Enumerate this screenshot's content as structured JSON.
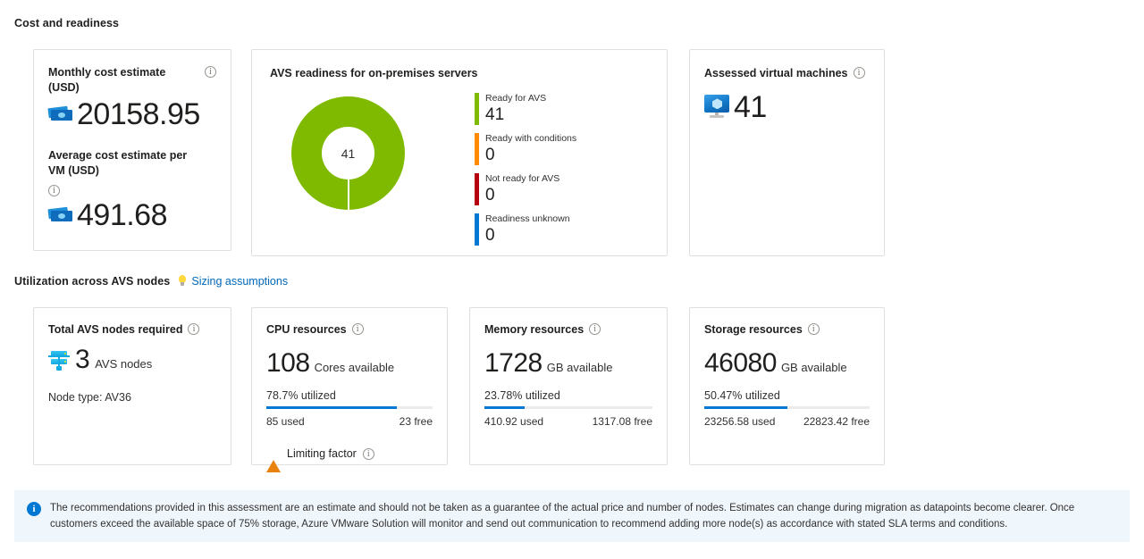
{
  "sections": {
    "cost_readiness_title": "Cost and readiness",
    "utilization_title": "Utilization across AVS nodes",
    "sizing_link": "Sizing assumptions"
  },
  "cost_card": {
    "monthly_label": "Monthly cost estimate (USD)",
    "monthly_value": "20158.95",
    "avg_label": "Average cost estimate per VM (USD)",
    "avg_value": "491.68"
  },
  "readiness_card": {
    "title": "AVS readiness for on-premises servers",
    "center_value": "41"
  },
  "assessed_card": {
    "title": "Assessed virtual machines",
    "value": "41"
  },
  "nodes_card": {
    "title": "Total AVS nodes required",
    "value": "3",
    "unit": "AVS nodes",
    "node_type": "Node type: AV36"
  },
  "cpu_card": {
    "title": "CPU resources",
    "value": "108",
    "unit": "Cores available",
    "utilized_text": "78.7% utilized",
    "utilized_percent": 78.7,
    "used_text": "85 used",
    "free_text": "23 free",
    "limiting_label": "Limiting factor"
  },
  "memory_card": {
    "title": "Memory resources",
    "value": "1728",
    "unit": "GB available",
    "utilized_text": "23.78% utilized",
    "utilized_percent": 23.78,
    "used_text": "410.92 used",
    "free_text": "1317.08 free"
  },
  "storage_card": {
    "title": "Storage resources",
    "value": "46080",
    "unit": "GB available",
    "utilized_text": "50.47% utilized",
    "utilized_percent": 50.47,
    "used_text": "23256.58 used",
    "free_text": "22823.42 free"
  },
  "banner": {
    "text": "The recommendations provided in this assessment are an estimate and should not be taken as a guarantee of the actual price and number of nodes. Estimates can change during migration as datapoints become clearer. Once customers exceed the available space of 75% storage, Azure VMware Solution will monitor and send out communication to recommend adding more node(s) as accordance with stated SLA terms and conditions."
  },
  "colors": {
    "ready": "#7FBA00",
    "conditions": "#FF8C00",
    "not_ready": "#B4000F",
    "unknown": "#0078D4",
    "accent": "#0078D4",
    "link": "#0067B8",
    "banner_bg": "#EFF6FC"
  },
  "chart_data": {
    "type": "pie",
    "title": "AVS readiness for on-premises servers",
    "center_label": "41",
    "legend_position": "right",
    "categories": [
      "Ready for AVS",
      "Ready with conditions",
      "Not ready for AVS",
      "Readiness unknown"
    ],
    "values": [
      41,
      0,
      0,
      0
    ],
    "colors": [
      "#7FBA00",
      "#FF8C00",
      "#B4000F",
      "#0078D4"
    ],
    "total": 41
  }
}
